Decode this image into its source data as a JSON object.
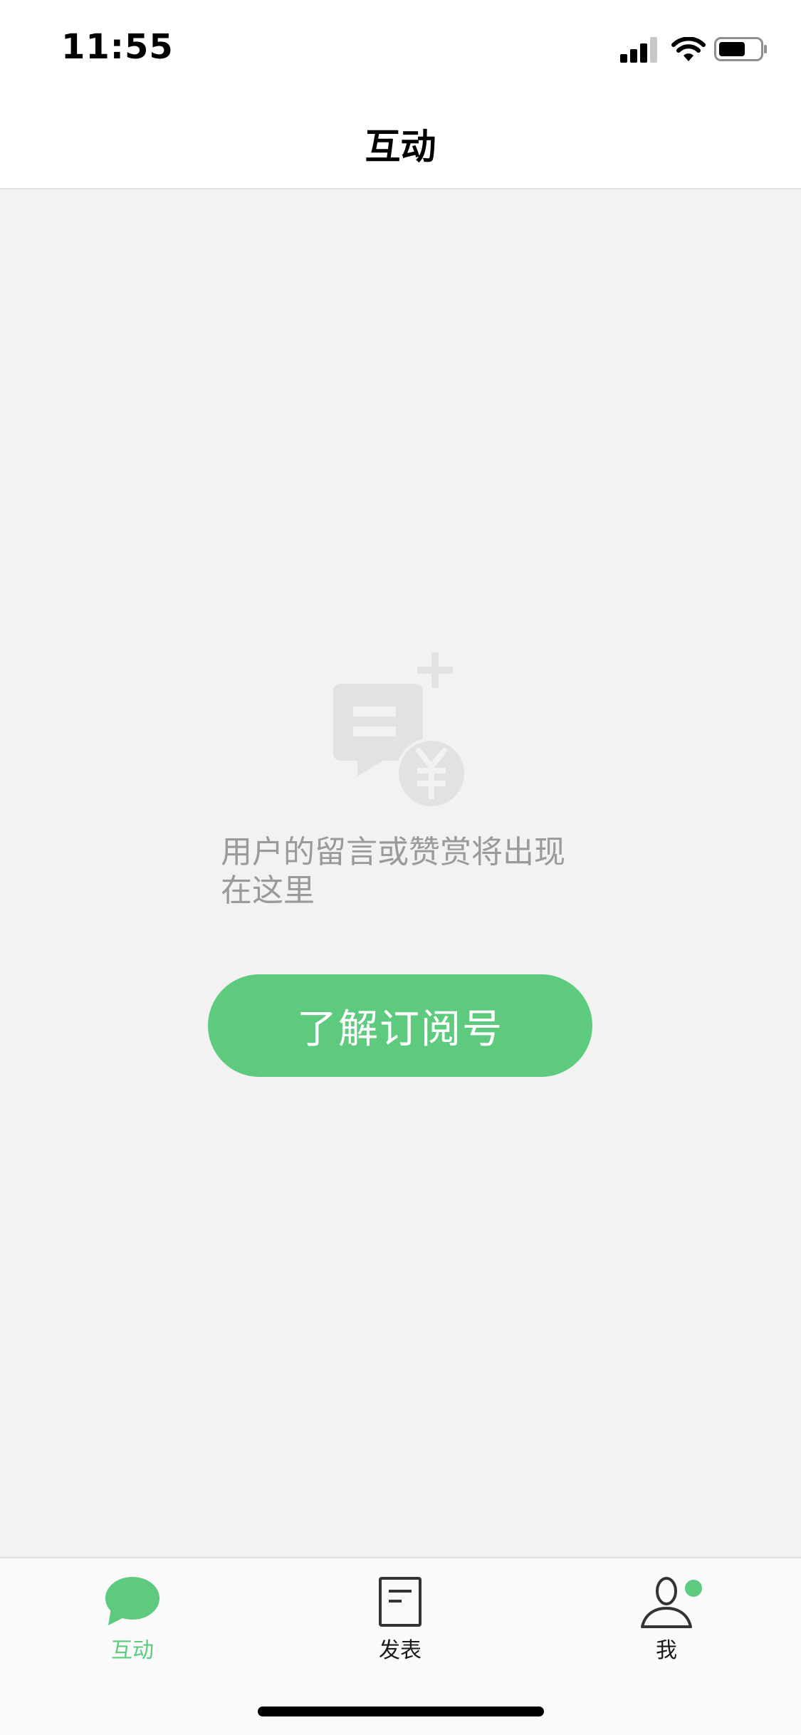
{
  "status_bar": {
    "time": "11:55",
    "icons": [
      "cellular-signal-icon",
      "wifi-icon",
      "battery-icon"
    ]
  },
  "header": {
    "title": "互动"
  },
  "empty_state": {
    "icon": "comment-reward-icon",
    "message": "用户的留言或赞赏将出现在这里",
    "button_label": "了解订阅号"
  },
  "tabbar": {
    "items": [
      {
        "label": "互动",
        "icon": "chat-bubble-icon",
        "active": true
      },
      {
        "label": "发表",
        "icon": "document-icon",
        "active": false
      },
      {
        "label": "我",
        "icon": "person-icon",
        "active": false,
        "badge": true
      }
    ]
  },
  "colors": {
    "accent": "#5dca7d",
    "background": "#f2f2f2",
    "placeholder_text": "#9a9a9a",
    "illustration": "#e2e2e2"
  }
}
